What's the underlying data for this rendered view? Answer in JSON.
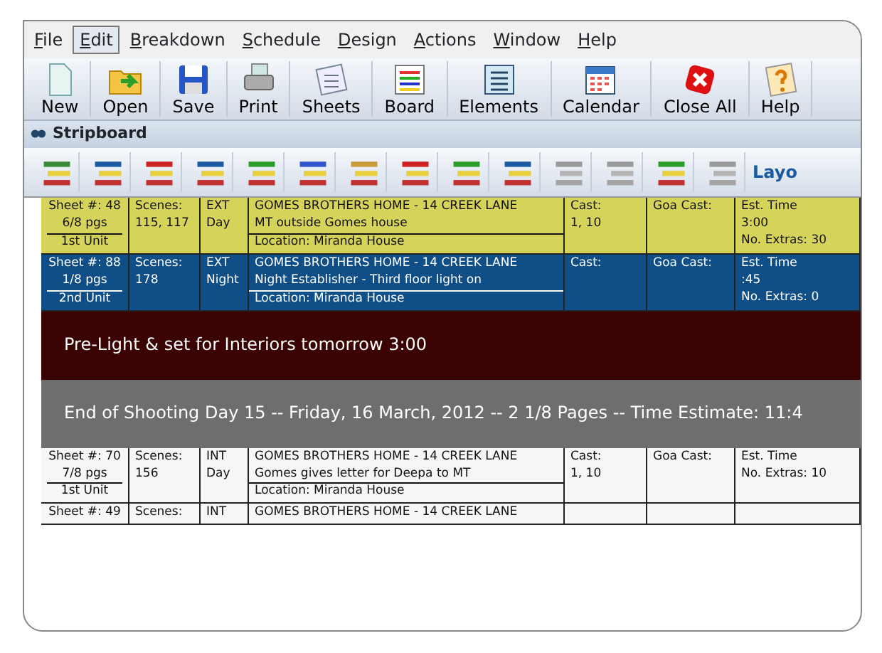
{
  "menu": [
    {
      "label": "File",
      "selected": false
    },
    {
      "label": "Edit",
      "selected": true
    },
    {
      "label": "Breakdown",
      "selected": false
    },
    {
      "label": "Schedule",
      "selected": false
    },
    {
      "label": "Design",
      "selected": false
    },
    {
      "label": "Actions",
      "selected": false
    },
    {
      "label": "Window",
      "selected": false
    },
    {
      "label": "Help",
      "selected": false
    }
  ],
  "toolbar": [
    "New",
    "Open",
    "Save",
    "Print",
    "Sheets",
    "Board",
    "Elements",
    "Calendar",
    "Close All",
    "Help"
  ],
  "panel_title": "Stripboard",
  "tools": [
    {
      "disabled": false
    },
    {
      "disabled": false
    },
    {
      "disabled": false
    },
    {
      "disabled": false
    },
    {
      "disabled": false
    },
    {
      "disabled": false
    },
    {
      "disabled": false
    },
    {
      "disabled": false
    },
    {
      "disabled": false
    },
    {
      "disabled": false
    },
    {
      "disabled": true
    },
    {
      "disabled": true
    },
    {
      "disabled": false
    },
    {
      "disabled": true
    }
  ],
  "layout_label": "Layo",
  "strips": [
    {
      "kind": "scene",
      "color": "#d6d35a",
      "sheet": "Sheet #:  48",
      "pages": "6/8   pgs",
      "unit": "1st Unit",
      "scenes_label": "Scenes:",
      "scenes": "115, 117",
      "int_ext": "EXT",
      "day_night": "Day",
      "set": "GOMES BROTHERS HOME - 14 CREEK LANE",
      "description": "MT outside Gomes house",
      "location": "Location: Miranda House",
      "cast_label": "Cast:",
      "cast": "1, 10",
      "goa_label": "Goa Cast:",
      "est_label": "Est. Time",
      "est": "3:00",
      "extras": "No. Extras: 30"
    },
    {
      "kind": "scene",
      "color": "#0f4e86",
      "sheet": "Sheet #:  88",
      "pages": "1/8   pgs",
      "unit": "2nd Unit",
      "scenes_label": "Scenes:",
      "scenes": "178",
      "int_ext": "EXT",
      "day_night": "Night",
      "set": "GOMES BROTHERS HOME - 14 CREEK LANE",
      "description": "Night Establisher - Third floor light on",
      "location": "Location: Miranda House",
      "cast_label": "Cast:",
      "goa_label": "Goa Cast:",
      "est_label": "Est. Time",
      "est": ":45",
      "extras": "No. Extras: 0"
    },
    {
      "kind": "banner",
      "color": "#3a0202",
      "text": "Pre-Light & set for Interiors tomorrow 3:00"
    },
    {
      "kind": "banner",
      "color": "#6e6e6e",
      "text": "End of Shooting Day 15 -- Friday, 16 March, 2012 -- 2 1/8 Pages -- Time Estimate: 11:4"
    },
    {
      "kind": "scene",
      "color": "#f6f6f8",
      "sheet": "Sheet #:  70",
      "pages": "7/8   pgs",
      "unit": "1st Unit",
      "scenes_label": "Scenes:",
      "scenes": "156",
      "int_ext": "INT",
      "day_night": "Day",
      "set": "GOMES BROTHERS HOME - 14 CREEK LANE",
      "description": "Gomes gives letter for Deepa to MT",
      "location": "Location: Miranda House",
      "cast_label": "Cast:",
      "cast": "1, 10",
      "goa_label": "Goa Cast:",
      "est_label": "Est. Time",
      "extras": "No. Extras: 10"
    },
    {
      "kind": "scene",
      "color": "#f6f6f8",
      "sheet": "Sheet #:  49",
      "scenes_label": "Scenes:",
      "int_ext": "INT",
      "set": "GOMES BROTHERS HOME - 14 CREEK LANE"
    }
  ]
}
